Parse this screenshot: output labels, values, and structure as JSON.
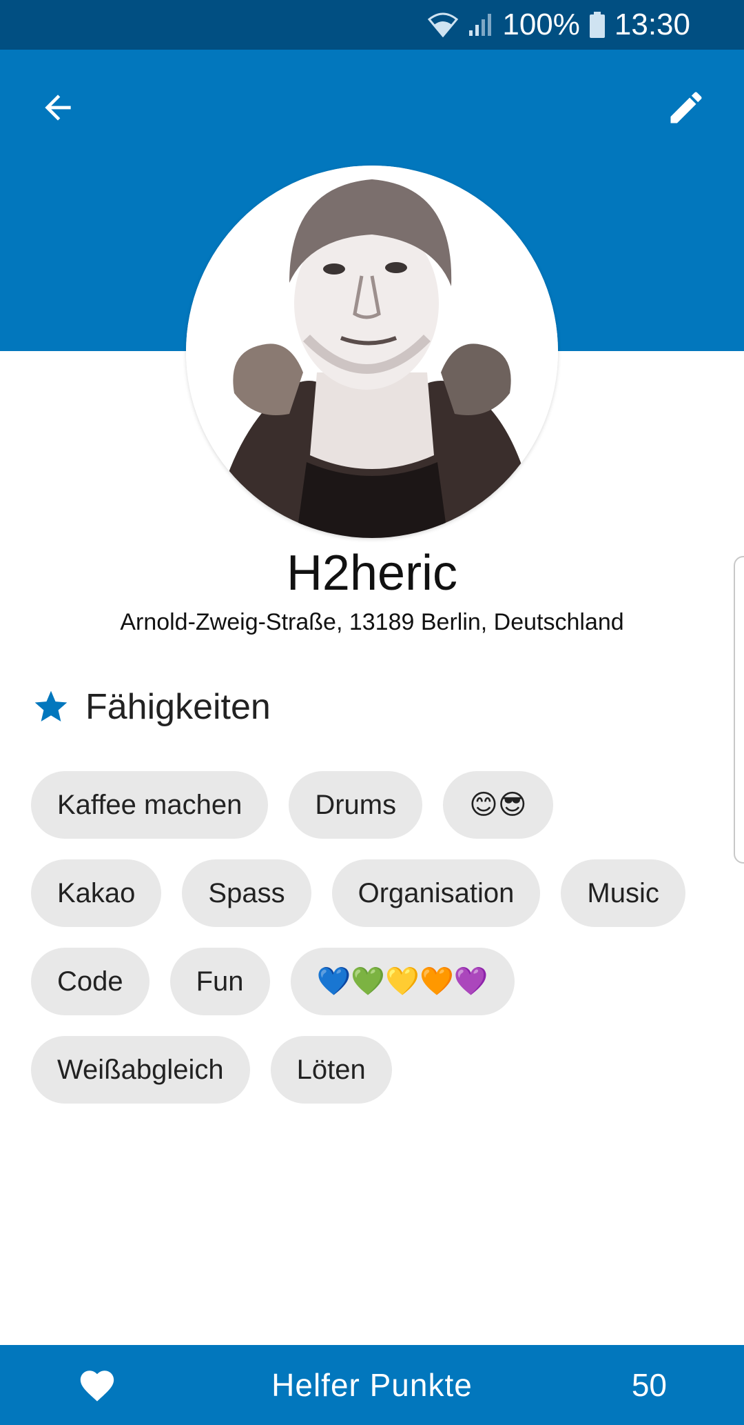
{
  "status_bar": {
    "battery": "100%",
    "time": "13:30"
  },
  "header": {
    "back_icon": "arrow-left-icon",
    "edit_icon": "pencil-icon"
  },
  "profile": {
    "name": "H2heric",
    "address": "Arnold-Zweig-Straße, 13189 Berlin, Deutschland"
  },
  "skills": {
    "icon": "star-icon",
    "title": "Fähigkeiten",
    "rows": [
      [
        "Kaffee machen",
        "Drums",
        "😊😎"
      ],
      [
        "Kakao",
        "Spass",
        "Organisation",
        "Music"
      ],
      [
        "Code",
        "Fun",
        "💙💚💛🧡💜"
      ],
      [
        "Weißabgleich",
        "Löten"
      ]
    ]
  },
  "bottom_bar": {
    "icon": "heart-icon",
    "label": "Helfer Punkte",
    "value": "50"
  },
  "colors": {
    "status_bar": "#014f82",
    "primary": "#0277bd",
    "chip": "#e8e8e8",
    "accent_star": "#0277bd"
  }
}
